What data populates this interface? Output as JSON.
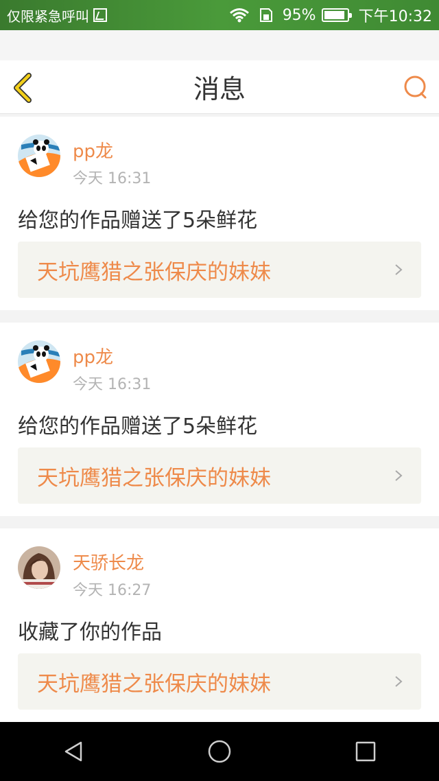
{
  "status_bar": {
    "carrier": "仅限紧急呼叫",
    "battery": "95%",
    "time": "下午10:32",
    "icons": [
      "sim-icon",
      "wifi-icon",
      "sd-card-icon",
      "battery-icon"
    ]
  },
  "header": {
    "title": "消息",
    "icons": [
      "back-chevron-icon",
      "search-icon"
    ]
  },
  "messages": [
    {
      "user": "pp龙",
      "time": "今天 16:31",
      "text": "给您的作品赠送了5朵鲜花",
      "work": "天坑鹰猎之张保庆的妹妹",
      "avatar": "panda-avatar"
    },
    {
      "user": "pp龙",
      "time": "今天 16:31",
      "text": "给您的作品赠送了5朵鲜花",
      "work": "天坑鹰猎之张保庆的妹妹",
      "avatar": "panda-avatar"
    },
    {
      "user": "天骄长龙",
      "time": "今天 16:27",
      "text": "收藏了你的作品",
      "work": "天坑鹰猎之张保庆的妹妹",
      "avatar": "girl-photo-avatar"
    }
  ],
  "colors": {
    "accent": "#ee8a4a",
    "status_bar": "#3f8a33",
    "back_icon": "#e6c200",
    "card_link_bg": "#f4f4ef"
  },
  "system_nav": [
    "back-triangle-icon",
    "home-circle-icon",
    "recents-square-icon"
  ]
}
